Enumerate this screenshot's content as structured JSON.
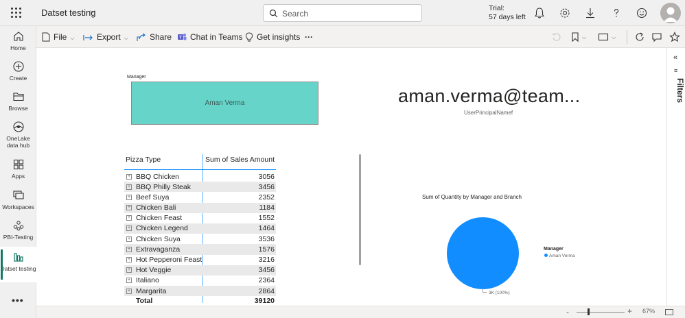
{
  "topbar": {
    "workspace_title": "Datset testing",
    "search_placeholder": "Search",
    "trial_line1": "Trial:",
    "trial_line2": "57 days left"
  },
  "leftnav": {
    "items": [
      {
        "label": "Home",
        "icon": "home-icon"
      },
      {
        "label": "Create",
        "icon": "create-icon"
      },
      {
        "label": "Browse",
        "icon": "browse-icon"
      },
      {
        "label": "OneLake data hub",
        "icon": "onelake-icon"
      },
      {
        "label": "Apps",
        "icon": "apps-icon"
      },
      {
        "label": "Workspaces",
        "icon": "workspaces-icon"
      },
      {
        "label": "PBI-Testing",
        "icon": "pbi-testing-icon"
      },
      {
        "label": "Datset testing",
        "icon": "report-icon"
      }
    ],
    "more": "•••"
  },
  "toolbar": {
    "file": "File",
    "export": "Export",
    "share": "Share",
    "chat": "Chat in Teams",
    "insights": "Get insights",
    "more": "···"
  },
  "report": {
    "slicer_label": "Manager",
    "slicer_value": "Aman Verma",
    "card_value": "aman.verma@team...",
    "card_label": "UserPrincipalNamef",
    "table": {
      "col1": "Pizza Type",
      "col2": "Sum of Sales Amount",
      "rows": [
        {
          "name": "BBQ Chicken",
          "value": "3056"
        },
        {
          "name": "BBQ Philly Steak",
          "value": "3456"
        },
        {
          "name": "Beef Suya",
          "value": "2352"
        },
        {
          "name": "Chicken Bali",
          "value": "1184"
        },
        {
          "name": "Chicken Feast",
          "value": "1552"
        },
        {
          "name": "Chicken Legend",
          "value": "1464"
        },
        {
          "name": "Chicken Suya",
          "value": "3536"
        },
        {
          "name": "Extravaganza",
          "value": "1576"
        },
        {
          "name": "Hot Pepperoni Feast",
          "value": "3216"
        },
        {
          "name": "Hot Veggie",
          "value": "3456"
        },
        {
          "name": "Italiano",
          "value": "2364"
        },
        {
          "name": "Margarita",
          "value": "2864"
        }
      ],
      "total_label": "Total",
      "total_value": "39120"
    },
    "pie_title": "Sum of Quantity by Manager and Branch",
    "pie_data_label": "3K (100%)",
    "legend_title": "Manager",
    "legend_item": "Aman Verma"
  },
  "filters": {
    "label": "Filters",
    "collapse": "«"
  },
  "statusbar": {
    "zoom_minus": "-",
    "zoom_plus": "+",
    "zoom": "67%"
  },
  "colors": {
    "slicer_fill": "#66d4c8",
    "pie_fill": "#118dff",
    "nav_accent": "#117865"
  }
}
